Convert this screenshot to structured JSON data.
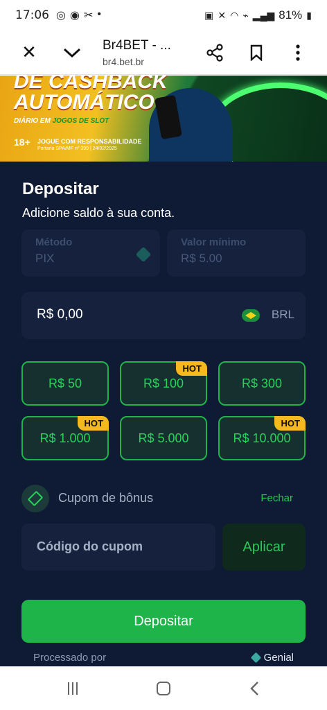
{
  "status_bar": {
    "time": "17:06",
    "left_icons": [
      "whatsapp-icon",
      "chrome-icon",
      "app-icon",
      "dot-icon"
    ],
    "right_icons": [
      "nfc-icon",
      "mute-icon",
      "wifi-icon",
      "volte-icon",
      "signal-icon"
    ],
    "battery": "81%"
  },
  "browser": {
    "title": "Br4BET - ...",
    "url": "br4.bet.br"
  },
  "banner": {
    "line1": "DE CASHBACK",
    "line2": "AUTOMÁTICO",
    "line3_prefix": "DIÁRIO EM",
    "line3_bold": "JOGOS DE SLOT",
    "age": "18+",
    "responsibility": "JOGUE COM RESPONSABILIDADE",
    "portaria": "Portaria SPA/MF nº 399 | 24/02/2025"
  },
  "deposit": {
    "title": "Depositar",
    "subtitle": "Adicione saldo à sua conta.",
    "method_label": "Método",
    "method_value": "PIX",
    "min_label": "Valor mínimo",
    "min_value": "R$ 5.00",
    "amount_value": "R$ 0,00",
    "currency": "BRL",
    "presets": [
      {
        "label": "R$ 50",
        "hot": false
      },
      {
        "label": "R$ 100",
        "hot": true
      },
      {
        "label": "R$ 300",
        "hot": false
      },
      {
        "label": "R$ 1.000",
        "hot": true
      },
      {
        "label": "R$ 5.000",
        "hot": false
      },
      {
        "label": "R$ 10.000",
        "hot": true
      }
    ],
    "hot_label": "HOT",
    "coupon_label": "Cupom de bônus",
    "coupon_close": "Fechar",
    "coupon_placeholder": "Código do cupom",
    "apply_label": "Aplicar",
    "deposit_button": "Depositar",
    "processed_by": "Processado por",
    "processor": "Genial"
  },
  "colors": {
    "background": "#0f1b34",
    "accent_green": "#1fb44a",
    "hot_badge": "#f5b81e"
  }
}
